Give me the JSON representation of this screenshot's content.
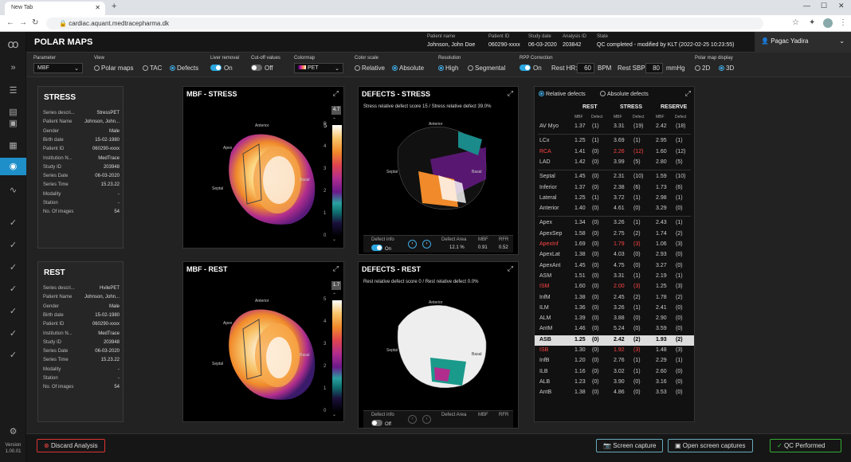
{
  "browser": {
    "tab_title": "New Tab",
    "url": "cardiac.aquant.medtracepharma.dk"
  },
  "header": {
    "title": "POLAR MAPS",
    "patient_name_label": "Patient name",
    "patient_name": "Johnson, John Doe",
    "patient_id_label": "Patient ID",
    "patient_id": "060290-xxxx",
    "study_date_label": "Study date",
    "study_date": "06-03-2020",
    "analysis_id_label": "Analysis ID",
    "analysis_id": "203842",
    "state_label": "State",
    "state": "QC completed - modified by KLT (2022-02-25 10:23:55)",
    "user": "Pagac Yadira"
  },
  "toolbar": {
    "parameter_label": "Parameter",
    "parameter_value": "MBF",
    "view_label": "View",
    "view_polar": "Polar maps",
    "view_tac": "TAC",
    "view_defects": "Defects",
    "liver_label": "Liver removal",
    "liver_value": "On",
    "cutoff_label": "Cut-off values",
    "cutoff_value": "Off",
    "colormap_label": "Colormap",
    "colormap_value": "PET",
    "colorscale_label": "Color scale",
    "relative": "Relative",
    "absolute": "Absolute",
    "resolution_label": "Resolution",
    "high": "High",
    "segmental": "Segmental",
    "rpp_label": "RPP Correction",
    "rpp_value": "On",
    "rest_hr_label": "Rest HR:",
    "rest_hr": "60",
    "bpm": "BPM",
    "rest_sbp_label": "Rest SBP:",
    "rest_sbp": "80",
    "mmhg": "mmHg",
    "display_label": "Polar map display",
    "d2": "2D",
    "d3": "3D"
  },
  "stress_info": {
    "title": "STRESS",
    "rows": [
      [
        "Series descri...",
        "StressPET"
      ],
      [
        "Patient Name",
        "Johnson, John..."
      ],
      [
        "Gender",
        "Male"
      ],
      [
        "Birth date",
        "15-02-1980"
      ],
      [
        "Patient ID",
        "060290-xxxx"
      ],
      [
        "Institution N...",
        "MedTrace"
      ],
      [
        "Study ID",
        "203948"
      ],
      [
        "Series Date",
        "06-03-2020"
      ],
      [
        "Series Time",
        "15.23.22"
      ],
      [
        "Modality",
        "-"
      ],
      [
        "Station",
        "-"
      ],
      [
        "No. Of images",
        "54"
      ]
    ]
  },
  "rest_info": {
    "title": "REST",
    "rows": [
      [
        "Series descri...",
        "HvilePET"
      ],
      [
        "Patient Name",
        "Johnson, John..."
      ],
      [
        "Gender",
        "Male"
      ],
      [
        "Birth date",
        "15-02-1980"
      ],
      [
        "Patient ID",
        "060290-xxxx"
      ],
      [
        "Institution N...",
        "MedTrace"
      ],
      [
        "Study ID",
        "203948"
      ],
      [
        "Series Date",
        "06-03-2020"
      ],
      [
        "Series Time",
        "15.23.22"
      ],
      [
        "Modality",
        "-"
      ],
      [
        "Station",
        "-"
      ],
      [
        "No. Of images",
        "54"
      ]
    ]
  },
  "mbf_stress": {
    "title": "MBF - STRESS",
    "max": "4.7",
    "ticks": [
      "5",
      "4",
      "3",
      "2",
      "1",
      "0"
    ],
    "anterior": "Anterior",
    "apex": "Apex",
    "septal": "Septal",
    "basal": "Basal",
    "lateral": "Lateral"
  },
  "mbf_rest": {
    "title": "MBF  - REST",
    "max": "1.7",
    "ticks": [
      "5",
      "4",
      "3",
      "2",
      "1",
      "0"
    ],
    "anterior": "Anterior",
    "apex": "Apex",
    "septal": "Septal",
    "basal": "Basal",
    "lateral": "Lateral"
  },
  "def_stress": {
    "title": "DEFECTS - STRESS",
    "summary": "Stress relative defect score 15 / Stress relative defect 39.0%",
    "anterior": "Anterior",
    "basal": "Basal",
    "septal": "Septal",
    "defect_info": "Defect info",
    "toggle": "On",
    "area_label": "Defect Area",
    "mbf_label": "MBF",
    "rfr_label": "RFR",
    "area": "12.1 %",
    "mbf": "0.91",
    "rfr": "0.52"
  },
  "def_rest": {
    "title": "DEFECTS - REST",
    "summary": "Rest relative defect score 0 / Rest relative defect 0.0%",
    "anterior": "Anterior",
    "basal": "Basal",
    "septal": "Septal",
    "defect_info": "Defect info",
    "toggle": "Off",
    "area_label": "Defect Area",
    "mbf_label": "MBF",
    "rfr_label": "RFR"
  },
  "table": {
    "relative": "Relative defects",
    "absolute": "Absolute defects",
    "rest": "REST",
    "stress": "STRESS",
    "reserve": "RESERVE",
    "mbf": "MBF",
    "defect": "Defect",
    "rows": [
      {
        "name": "AV Myo",
        "v": [
          "1.37",
          "(1)",
          "3.31",
          "(19)",
          "2.42",
          "(18)"
        ]
      },
      {
        "name": "LCx",
        "v": [
          "1.25",
          "(1)",
          "3.69",
          "(1)",
          "2.95",
          "(1)"
        ]
      },
      {
        "name": "RCA",
        "red": true,
        "v": [
          "1.41",
          "(0)",
          "2.26",
          "(12)",
          "1.60",
          "(12)"
        ]
      },
      {
        "name": "LAD",
        "v": [
          "1.42",
          "(0)",
          "3.99",
          "(5)",
          "2.80",
          "(5)"
        ]
      },
      {
        "name": "Septal",
        "v": [
          "1.45",
          "(0)",
          "2.31",
          "(10)",
          "1.59",
          "(10)"
        ]
      },
      {
        "name": "Inferior",
        "v": [
          "1.37",
          "(0)",
          "2.38",
          "(6)",
          "1.73",
          "(6)"
        ]
      },
      {
        "name": "Lateral",
        "v": [
          "1.25",
          "(1)",
          "3.72",
          "(1)",
          "2.98",
          "(1)"
        ]
      },
      {
        "name": "Anterior",
        "v": [
          "1.40",
          "(0)",
          "4.61",
          "(0)",
          "3.29",
          "(0)"
        ]
      },
      {
        "name": "Apex",
        "v": [
          "1.34",
          "(0)",
          "3.26",
          "(1)",
          "2.43",
          "(1)"
        ]
      },
      {
        "name": "ApexSep",
        "v": [
          "1.58",
          "(0)",
          "2.75",
          "(2)",
          "1.74",
          "(2)"
        ]
      },
      {
        "name": "ApexInf",
        "red": true,
        "v": [
          "1.69",
          "(0)",
          "1.79",
          "(3)",
          "1.06",
          "(3)"
        ]
      },
      {
        "name": "ApexLat",
        "v": [
          "1.38",
          "(0)",
          "4.03",
          "(0)",
          "2.93",
          "(0)"
        ]
      },
      {
        "name": "ApexAnt",
        "v": [
          "1.45",
          "(0)",
          "4.75",
          "(0)",
          "3.27",
          "(0)"
        ]
      },
      {
        "name": "ASM",
        "v": [
          "1.51",
          "(0)",
          "3.31",
          "(1)",
          "2.19",
          "(1)"
        ]
      },
      {
        "name": "ISM",
        "red": true,
        "v": [
          "1.60",
          "(0)",
          "2.00",
          "(3)",
          "1.25",
          "(3)"
        ]
      },
      {
        "name": "InfM",
        "v": [
          "1.38",
          "(0)",
          "2.45",
          "(2)",
          "1.78",
          "(2)"
        ]
      },
      {
        "name": "ILM",
        "v": [
          "1.36",
          "(0)",
          "3.26",
          "(1)",
          "2.41",
          "(0)"
        ]
      },
      {
        "name": "ALM",
        "v": [
          "1.39",
          "(0)",
          "3.88",
          "(0)",
          "2.90",
          "(0)"
        ]
      },
      {
        "name": "AntM",
        "v": [
          "1.46",
          "(0)",
          "5.24",
          "(0)",
          "3.59",
          "(0)"
        ]
      },
      {
        "name": "ASB",
        "bold": true,
        "v": [
          "1.25",
          "(0)",
          "2.42",
          "(2)",
          "1.93",
          "(2)"
        ]
      },
      {
        "name": "ISB",
        "red": true,
        "v": [
          "1.30",
          "(0)",
          "1.92",
          "(3)",
          "1.48",
          "(3)"
        ]
      },
      {
        "name": "InfB",
        "v": [
          "1.20",
          "(0)",
          "2.76",
          "(1)",
          "2.29",
          "(1)"
        ]
      },
      {
        "name": "ILB",
        "v": [
          "1.16",
          "(0)",
          "3.02",
          "(1)",
          "2.60",
          "(0)"
        ]
      },
      {
        "name": "ALB",
        "v": [
          "1.23",
          "(0)",
          "3.90",
          "(0)",
          "3.16",
          "(0)"
        ]
      },
      {
        "name": "AntB",
        "v": [
          "1.38",
          "(0)",
          "4.86",
          "(0)",
          "3.53",
          "(0)"
        ]
      }
    ]
  },
  "footer": {
    "discard": "Discard Analysis",
    "capture": "Screen capture",
    "open_captures": "Open screen captures",
    "qc": "QC Performed"
  },
  "version": {
    "label": "Version",
    "value": "1.00.01"
  }
}
